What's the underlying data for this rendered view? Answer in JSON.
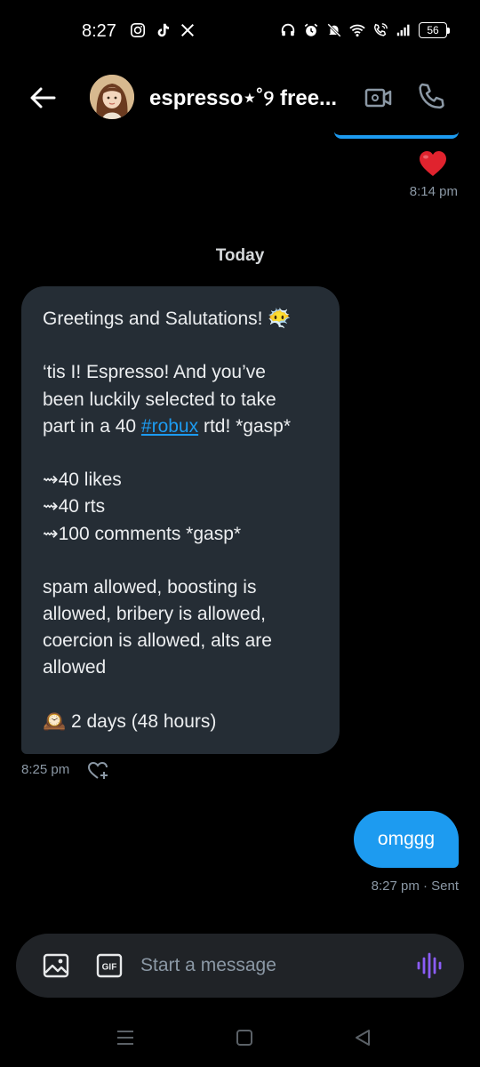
{
  "status_bar": {
    "time": "8:27",
    "left_icons": [
      "instagram-icon",
      "tiktok-icon",
      "x-icon"
    ],
    "right_icons": [
      "headphones-icon",
      "alarm-icon",
      "mute-icon",
      "wifi-icon",
      "wifi-call-icon",
      "signal-icon"
    ],
    "battery": "56"
  },
  "header": {
    "title": "espresso⋆˚୨ free...",
    "back_icon": "arrow-left-icon",
    "video_icon": "video-call-icon",
    "call_icon": "phone-icon"
  },
  "messages": {
    "heart_reaction_time": "8:14 pm",
    "day_divider": "Today",
    "incoming": {
      "lines": [
        "Greetings and Salutations! 😶‍🌫️",
        "",
        "‘tis I! Espresso! And you’ve",
        "been luckily selected to take",
        "part in a 40 ",
        "",
        "⇝40 likes",
        "⇝40 rts",
        "⇝100 comments *gasp*",
        "",
        "spam allowed, boosting is",
        "allowed, bribery is allowed,",
        "coercion is allowed, alts are",
        "allowed",
        "",
        "🕰️ 2 days (48 hours)"
      ],
      "hashtag": "#robux",
      "after_hashtag": " rtd! *gasp*",
      "time": "8:25 pm"
    },
    "outgoing": {
      "text": "omggg",
      "time": "8:27 pm · Sent"
    }
  },
  "composer": {
    "placeholder": "Start a message",
    "gif_label": "GIF"
  },
  "colors": {
    "accent": "#1d9bf0",
    "incoming_bg": "#252d35",
    "composer_bg": "#202327",
    "voice": "#8b5cf6"
  }
}
